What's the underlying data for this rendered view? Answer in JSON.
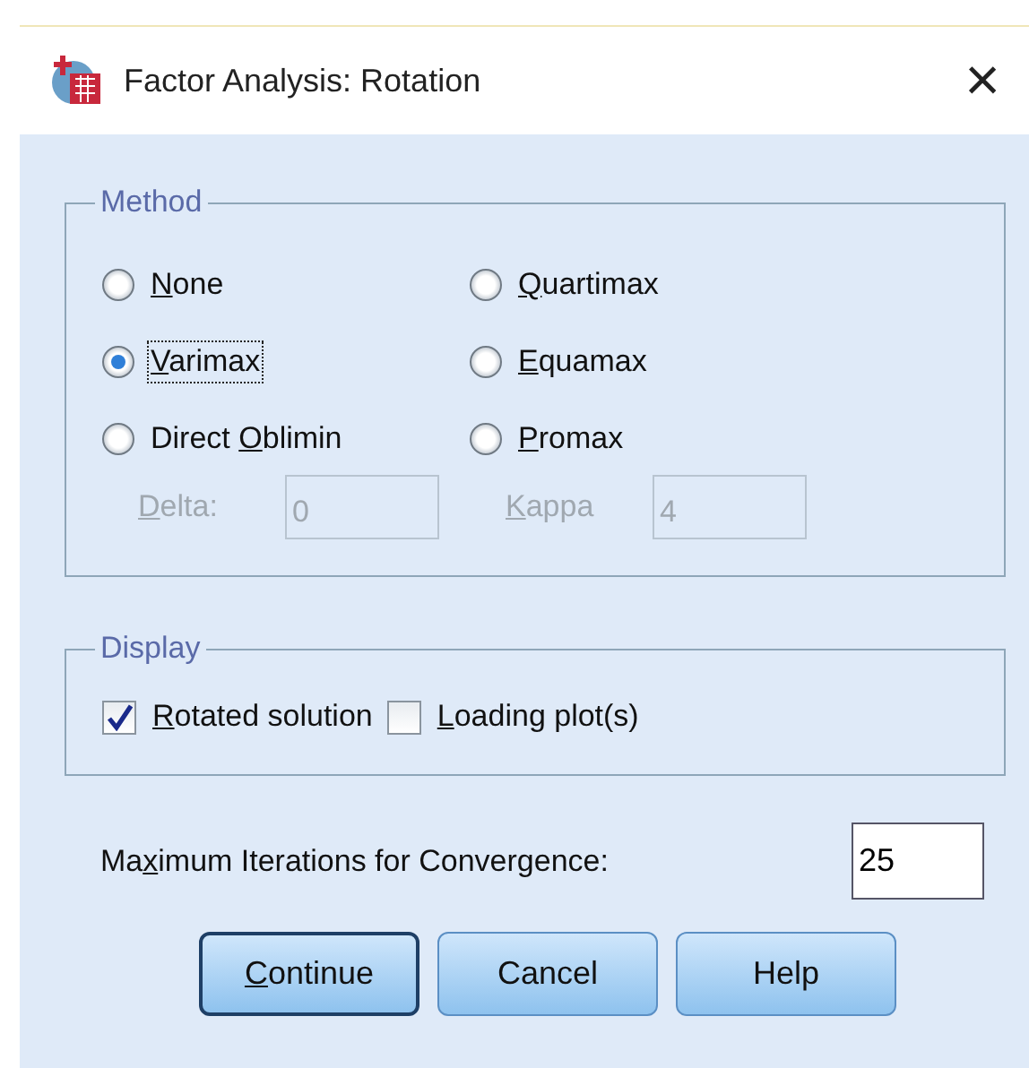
{
  "window": {
    "title": "Factor Analysis: Rotation",
    "close": "×"
  },
  "method": {
    "legend": "Method",
    "options": [
      {
        "label": {
          "key": "N",
          "post": "one"
        },
        "selected": false,
        "focused": false
      },
      {
        "label": {
          "key": "Q",
          "post": "uartimax"
        },
        "selected": false,
        "focused": false
      },
      {
        "label": {
          "key": "V",
          "post": "arimax"
        },
        "selected": true,
        "focused": true
      },
      {
        "label": {
          "key": "E",
          "post": "quamax"
        },
        "selected": false,
        "focused": false
      },
      {
        "label": {
          "pre": "Direct ",
          "key": "O",
          "post": "blimin"
        },
        "selected": false,
        "focused": false
      },
      {
        "label": {
          "key": "P",
          "post": "romax"
        },
        "selected": false,
        "focused": false
      }
    ],
    "params": [
      {
        "label": {
          "key": "D",
          "post": "elta:"
        },
        "value": "0",
        "disabled": true
      },
      {
        "label": {
          "key": "K",
          "post": "appa"
        },
        "value": "4",
        "disabled": true
      }
    ]
  },
  "display": {
    "legend": "Display",
    "options": [
      {
        "label": {
          "key": "R",
          "post": "otated solution"
        },
        "checked": true
      },
      {
        "label": {
          "key": "L",
          "post": "oading plot(s)"
        },
        "checked": false
      }
    ]
  },
  "iterations": {
    "label": {
      "pre": "Ma",
      "key": "x",
      "post": "imum Iterations for Convergence:"
    },
    "value": "25"
  },
  "buttons": [
    {
      "label": {
        "key": "C",
        "post": "ontinue"
      },
      "default": true
    },
    {
      "label": {
        "post": "Cancel"
      },
      "default": false
    },
    {
      "label": {
        "post": "Help"
      },
      "default": false
    }
  ]
}
